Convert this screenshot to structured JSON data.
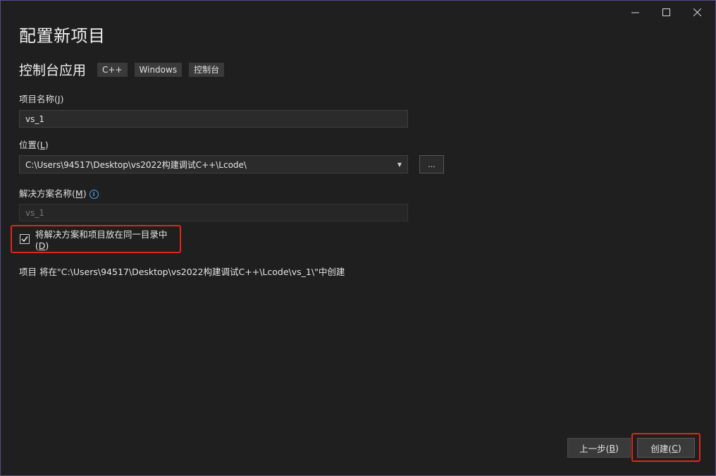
{
  "window": {
    "minimize_label": "—",
    "maximize_label": "☐",
    "close_label": "✕"
  },
  "title": "配置新项目",
  "template": {
    "name": "控制台应用",
    "tags": [
      "C++",
      "Windows",
      "控制台"
    ]
  },
  "project_name": {
    "label_prefix": "项目名称(",
    "label_key": "J",
    "label_suffix": ")",
    "value": "vs_1"
  },
  "location": {
    "label_prefix": "位置(",
    "label_key": "L",
    "label_suffix": ")",
    "value": "C:\\Users\\94517\\Desktop\\vs2022构建调试C++\\Lcode\\",
    "browse_label": "..."
  },
  "solution_name": {
    "label_prefix": "解决方案名称(",
    "label_key": "M",
    "label_suffix": ")",
    "placeholder": "vs_1"
  },
  "same_dir": {
    "label_prefix": "将解决方案和项目放在同一目录中(",
    "label_key": "D",
    "label_suffix": ")",
    "checked": true
  },
  "summary": "项目 将在\"C:\\Users\\94517\\Desktop\\vs2022构建调试C++\\Lcode\\vs_1\\\"中创建",
  "buttons": {
    "back_prefix": "上一步(",
    "back_key": "B",
    "back_suffix": ")",
    "create_prefix": "创建(",
    "create_key": "C",
    "create_suffix": ")"
  },
  "colors": {
    "background": "#1f1f1f",
    "highlight_border": "#e0261a",
    "info_icon": "#4aa3ff"
  }
}
